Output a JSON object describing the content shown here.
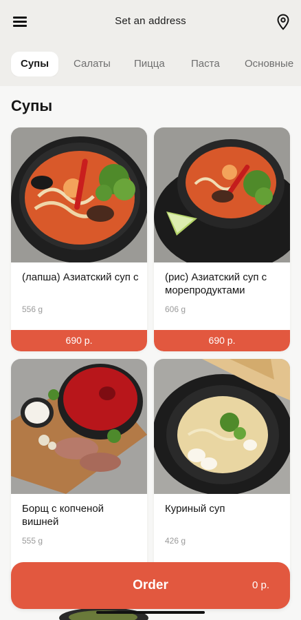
{
  "header": {
    "menu_icon": "hamburger-menu-icon",
    "address_label": "Set an address",
    "location_icon": "map-pin-icon"
  },
  "tabs": [
    {
      "label": "Супы",
      "active": true
    },
    {
      "label": "Салаты",
      "active": false
    },
    {
      "label": "Пицца",
      "active": false
    },
    {
      "label": "Паста",
      "active": false
    },
    {
      "label": "Основные",
      "active": false
    }
  ],
  "section": {
    "title": "Супы"
  },
  "products": [
    {
      "name": "(лапша) Азиатский суп с",
      "weight": "556 g",
      "price": "690 р."
    },
    {
      "name": "(рис) Азиатский суп с морепродуктами",
      "weight": "606 g",
      "price": "690 р."
    },
    {
      "name": "Борщ с копченой вишней",
      "weight": "555 g",
      "price": ""
    },
    {
      "name": "Куриный суп",
      "weight": "426 g",
      "price": ""
    }
  ],
  "order": {
    "label": "Order",
    "total": "0 р."
  },
  "colors": {
    "accent": "#e2583f",
    "header_bg": "#efeeeb",
    "page_bg": "#f7f7f6"
  }
}
